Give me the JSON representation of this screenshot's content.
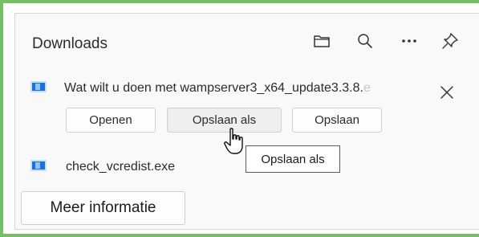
{
  "panel": {
    "title": "Downloads",
    "toolbar": [
      {
        "icon": "folder-icon"
      },
      {
        "icon": "search-icon"
      },
      {
        "icon": "more-options-icon",
        "glyph": "···"
      },
      {
        "icon": "pin-icon"
      }
    ]
  },
  "prompt_item": {
    "icon": "file-icon",
    "text_visible": "Wat wilt u doen met wampserver3_x64_update3.3.8.",
    "text_fade": "e",
    "close_icon": "close-icon",
    "actions": {
      "open_label": "Openen",
      "save_as_label": "Opslaan als",
      "save_label": "Opslaan"
    }
  },
  "tooltip": {
    "text": "Opslaan als"
  },
  "download_item": {
    "icon": "file-icon",
    "filename": "check_vcredist.exe"
  },
  "footer": {
    "more_info_label": "Meer informatie"
  },
  "colors": {
    "accent_border": "#74c165",
    "file_icon_blue": "#1a73d9"
  }
}
